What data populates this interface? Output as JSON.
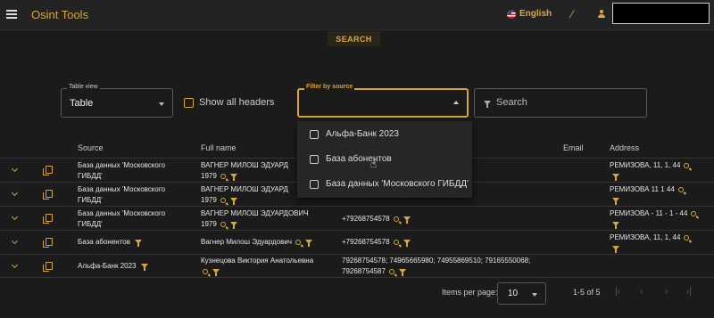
{
  "header": {
    "title": "Osint Tools",
    "language": "English"
  },
  "search_button": "SEARCH",
  "filters": {
    "table_view_label": "Table view",
    "table_view_value": "Table",
    "show_all_headers": "Show all headers",
    "filter_by_source_label": "Filter by source",
    "search_placeholder": "Search"
  },
  "source_options": [
    "Альфа-Банк 2023",
    "База абонентов",
    "База данных 'Московского ГИБДД'"
  ],
  "columns": {
    "source": "Source",
    "full_name": "Full name",
    "email": "Email",
    "address": "Address"
  },
  "rows": [
    {
      "source_l1": "База данных 'Московского",
      "source_l2": "ГИБДД'",
      "name_l1": "ВАГНЕР МИЛОШ ЭДУАРД",
      "name_l2": "1979",
      "phone": "",
      "address": "РЕМИЗОВА, 11, 1, 44"
    },
    {
      "source_l1": "База данных 'Московского",
      "source_l2": "ГИБДД'",
      "name_l1": "ВАГНЕР МИЛОШ ЭДУАРД",
      "name_l2": "1979",
      "phone": "",
      "address": "РЕМИЗОВА 11 1 44"
    },
    {
      "source_l1": "База данных 'Московского",
      "source_l2": "ГИБДД'",
      "name_l1": "ВАГНЕР МИЛОШ ЭДУАРДОВИЧ",
      "name_l2": "1979",
      "phone": "+79268754578",
      "address": "РЕМИЗОВА - 11 - 1 - 44"
    },
    {
      "source_l1": "База абонентов",
      "source_l2": "",
      "name_l1": "Вагнер Милош Эдуардович",
      "name_l2": "",
      "phone": "+79268754578",
      "address": "РЕМИЗОВА, 11, 1, 44"
    },
    {
      "source_l1": "Альфа-Банк 2023",
      "source_l2": "",
      "name_l1": "Кузнецова Виктория Анатольевна",
      "name_l2": "",
      "phone": "79268754578; 74965665980; 74955869510; 79165550068;",
      "phone_l2": "79268754587",
      "address": ""
    }
  ],
  "pagination": {
    "items_per_page_label": "Items per page:",
    "items_per_page": "10",
    "range": "1-5 of 5"
  },
  "icons": {
    "menu": "menu-icon",
    "lang_flag": "us-flag-icon",
    "wand": "magic-wand-icon",
    "user": "user-icon"
  },
  "colors": {
    "accent": "#d9a43a",
    "background": "#1b1b1b",
    "topbar": "#232323"
  }
}
